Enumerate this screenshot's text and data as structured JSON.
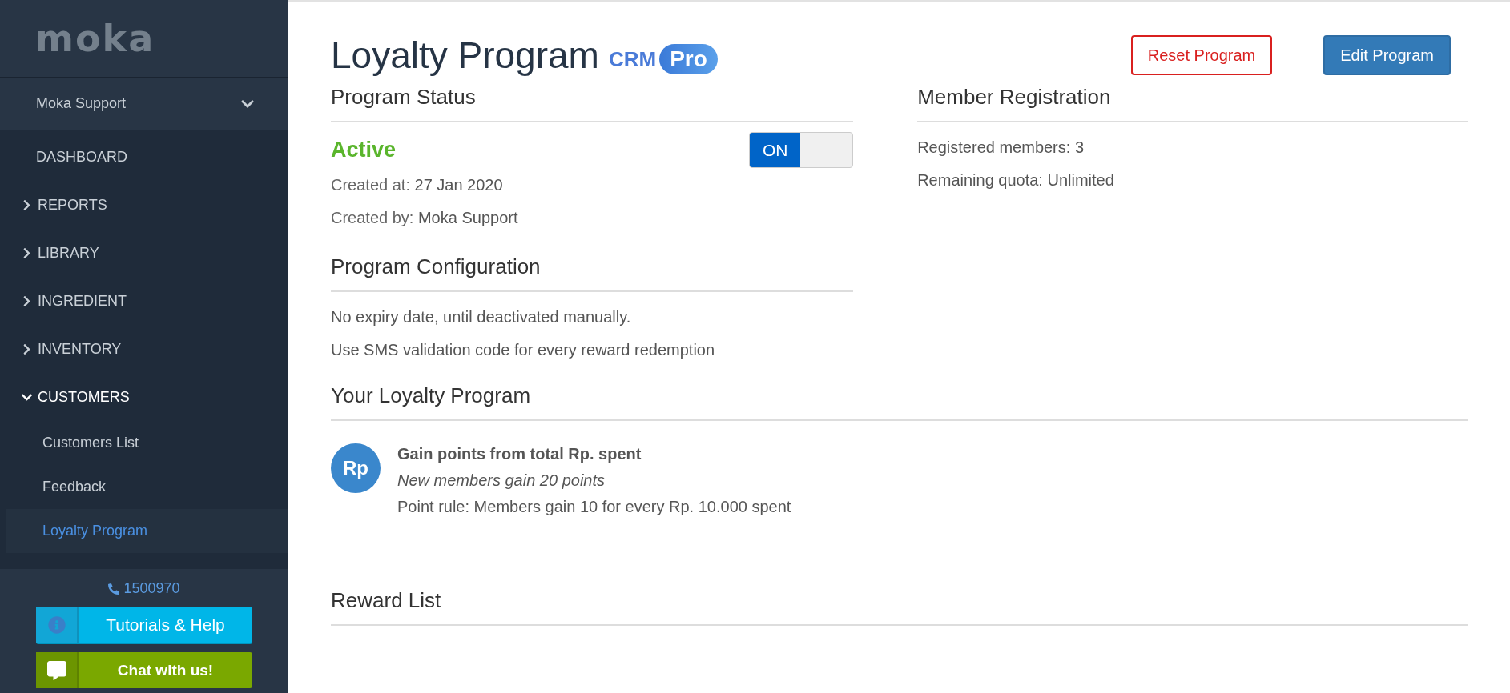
{
  "sidebar": {
    "logo": "moka",
    "account": {
      "name": "Moka Support",
      "expanded": false
    },
    "items": [
      {
        "kind": "link",
        "label": "DASHBOARD"
      },
      {
        "kind": "group",
        "label": "REPORTS",
        "expanded": false
      },
      {
        "kind": "group",
        "label": "LIBRARY",
        "expanded": false
      },
      {
        "kind": "group",
        "label": "INGREDIENT",
        "expanded": false
      },
      {
        "kind": "group",
        "label": "INVENTORY",
        "expanded": false
      },
      {
        "kind": "group",
        "label": "CUSTOMERS",
        "expanded": true,
        "children": [
          {
            "label": "Customers List",
            "selected": false
          },
          {
            "label": "Feedback",
            "selected": false
          },
          {
            "label": "Loyalty Program",
            "selected": true
          }
        ]
      }
    ],
    "phone": "1500970",
    "help_button": "Tutorials & Help",
    "chat_button": "Chat with us!"
  },
  "header": {
    "title": "Loyalty Program",
    "tag": "CRM",
    "badge": "Pro",
    "buttons": [
      {
        "kind": "outline",
        "label": "Reset Program"
      },
      {
        "kind": "primary",
        "label": "Edit Program"
      }
    ]
  },
  "program_status": {
    "heading": "Program Status",
    "status": "Active",
    "toggle": {
      "on": true,
      "label": "ON"
    },
    "details": [
      {
        "label": "Created at:",
        "value": "27 Jan 2020"
      },
      {
        "label": "Created by:",
        "value": "Moka Support"
      }
    ]
  },
  "member_registration": {
    "heading": "Member Registration",
    "lines": [
      "Registered members: 3",
      "Remaining quota: Unlimited"
    ]
  },
  "program_configuration": {
    "heading": "Program Configuration",
    "lines": [
      "No expiry date, until deactivated manually.",
      "Use SMS validation code for every reward redemption"
    ]
  },
  "your_loyalty_program": {
    "heading": "Your Loyalty Program",
    "avatar": "Rp",
    "title": "Gain points from total Rp. spent",
    "subtitle": "New members gain 20 points",
    "rule": "Point rule: Members gain 10 for every Rp. 10.000 spent"
  },
  "reward_list": {
    "heading": "Reward List"
  }
}
